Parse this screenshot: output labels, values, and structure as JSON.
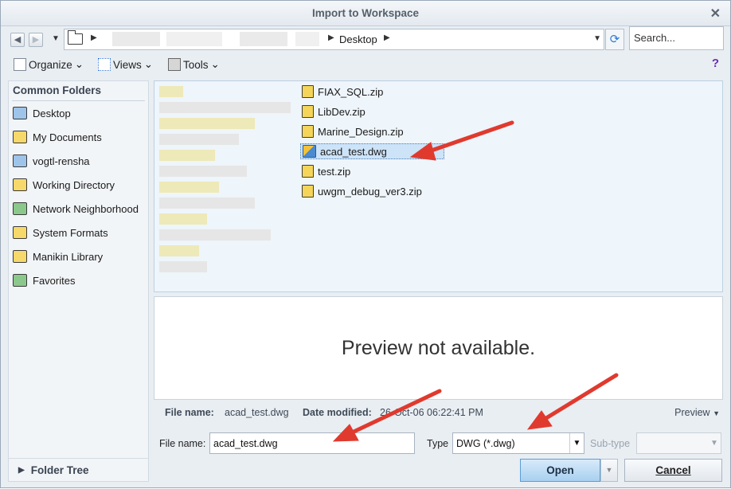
{
  "window": {
    "title": "Import to Workspace",
    "close_glyph": "✕"
  },
  "addressbar": {
    "back_glyph": "◀",
    "forward_glyph": "▶",
    "history_glyph": "▼",
    "crumb_arrow": "▶",
    "current_folder": "Desktop",
    "dropdown_glyph": "▼",
    "refresh_icon": "refresh-icon",
    "search_placeholder": "Search..."
  },
  "toolbar": {
    "organize_label": "Organize",
    "views_label": "Views",
    "tools_label": "Tools",
    "chevron": "⌄",
    "help_glyph": "?"
  },
  "sidebar": {
    "header": "Common Folders",
    "items": [
      {
        "label": "Desktop",
        "icon": "desktop-icon"
      },
      {
        "label": "My Documents",
        "icon": "documents-icon"
      },
      {
        "label": "vogtl-rensha",
        "icon": "computer-icon"
      },
      {
        "label": "Working Directory",
        "icon": "working-directory-icon"
      },
      {
        "label": "Network Neighborhood",
        "icon": "network-icon"
      },
      {
        "label": "System Formats",
        "icon": "system-formats-icon"
      },
      {
        "label": "Manikin Library",
        "icon": "manikin-library-icon"
      },
      {
        "label": "Favorites",
        "icon": "favorites-icon"
      }
    ],
    "folder_tree_label": "Folder Tree",
    "folder_tree_glyph": "▶"
  },
  "files": {
    "items": [
      {
        "name": "FIAX_SQL.zip",
        "type": "zip"
      },
      {
        "name": "LibDev.zip",
        "type": "zip"
      },
      {
        "name": "Marine_Design.zip",
        "type": "zip"
      },
      {
        "name": "acad_test.dwg",
        "type": "dwg",
        "selected": true
      },
      {
        "name": "test.zip",
        "type": "zip"
      },
      {
        "name": "uwgm_debug_ver3.zip",
        "type": "zip"
      }
    ]
  },
  "preview": {
    "message": "Preview not available."
  },
  "info": {
    "file_name_label": "File name:",
    "file_name_value": "acad_test.dwg",
    "date_modified_label": "Date modified:",
    "date_modified_value": "26-Oct-06 06:22:41 PM",
    "preview_label": "Preview",
    "preview_glyph": "▼"
  },
  "form": {
    "file_name_label": "File name:",
    "file_name_value": "acad_test.dwg",
    "type_label": "Type",
    "type_value": "DWG (*.dwg)",
    "subtype_label": "Sub-type",
    "dropdown_glyph": "▼"
  },
  "buttons": {
    "open_label": "Open",
    "cancel_label": "Cancel",
    "open_drop_glyph": "▼"
  },
  "colors": {
    "accent": "#2a7bd6",
    "annotation_arrow": "#e03a2e",
    "selection": "#cde3f7"
  }
}
